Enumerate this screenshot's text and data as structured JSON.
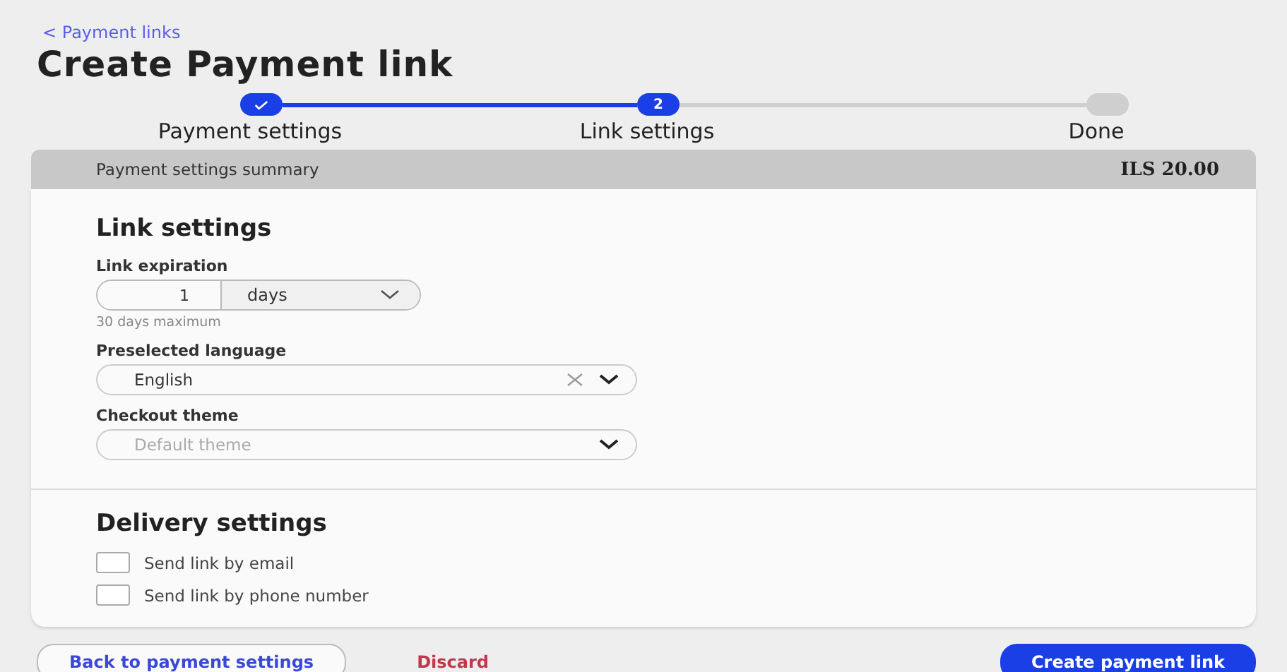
{
  "back_link": "< Payment links",
  "title": "Create Payment link",
  "steps": [
    {
      "label": "Payment settings",
      "done": true,
      "selected": false
    },
    {
      "label": "Link settings",
      "done": false,
      "selected": true,
      "number": "2"
    },
    {
      "label": "Done",
      "done": false,
      "selected": false
    }
  ],
  "summary": {
    "label": "Payment settings summary",
    "amount": "ILS 20.00"
  },
  "link_settings": {
    "heading": "Link settings",
    "expiration": {
      "label": "Link expiration",
      "value": "1",
      "unit": "days",
      "hint": "30 days maximum"
    },
    "language": {
      "label": "Preselected language",
      "value": "English"
    },
    "theme": {
      "label": "Checkout theme",
      "placeholder": "Default theme"
    }
  },
  "delivery": {
    "heading": "Delivery settings",
    "options": [
      {
        "label": "Send link by email",
        "checked": false
      },
      {
        "label": "Send link by phone number",
        "checked": false
      }
    ]
  },
  "footer": {
    "back_button": "Back to payment settings",
    "discard_button": "Discard",
    "create_button": "Create payment link"
  }
}
